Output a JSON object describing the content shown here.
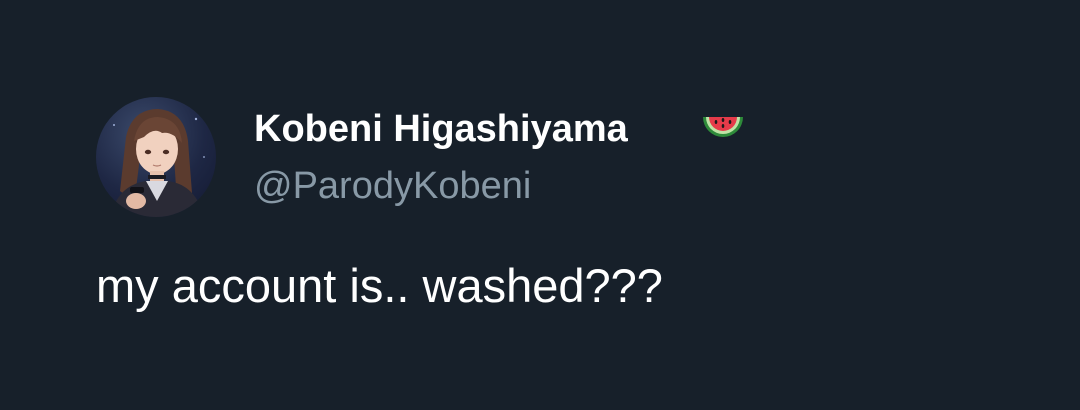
{
  "tweet": {
    "author": {
      "display_name": "Kobeni Higashiyama",
      "handle": "@ParodyKobeni",
      "name_emoji": "watermelon-icon"
    },
    "text": "my account is.. washed???"
  },
  "colors": {
    "background": "#17202a",
    "primary_text": "#ffffff",
    "secondary_text": "#8899a6"
  }
}
